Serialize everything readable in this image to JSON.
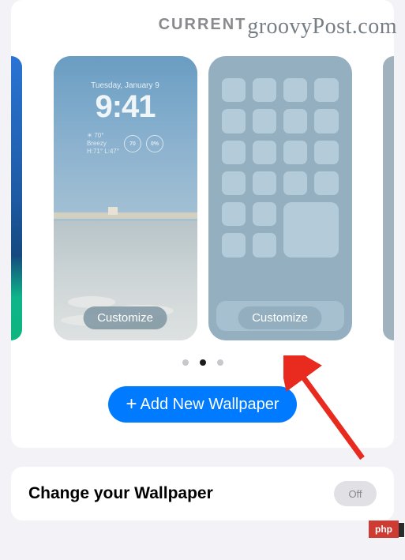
{
  "watermark": "groovyPost.com",
  "section_title": "CURRENT",
  "lock_screen": {
    "date": "Tuesday, January 9",
    "time": "9:41",
    "weather_temp": "☀ 70°",
    "weather_cond": "Breezy",
    "weather_hl": "H:71° L:47°",
    "ring1": "70",
    "ring2": "0%",
    "customize_label": "Customize"
  },
  "home_screen": {
    "customize_label": "Customize"
  },
  "add_button": {
    "plus": "+",
    "label": "Add New Wallpaper"
  },
  "change_section": {
    "title": "Change your Wallpaper",
    "toggle": "Off"
  },
  "php_badge": "php"
}
